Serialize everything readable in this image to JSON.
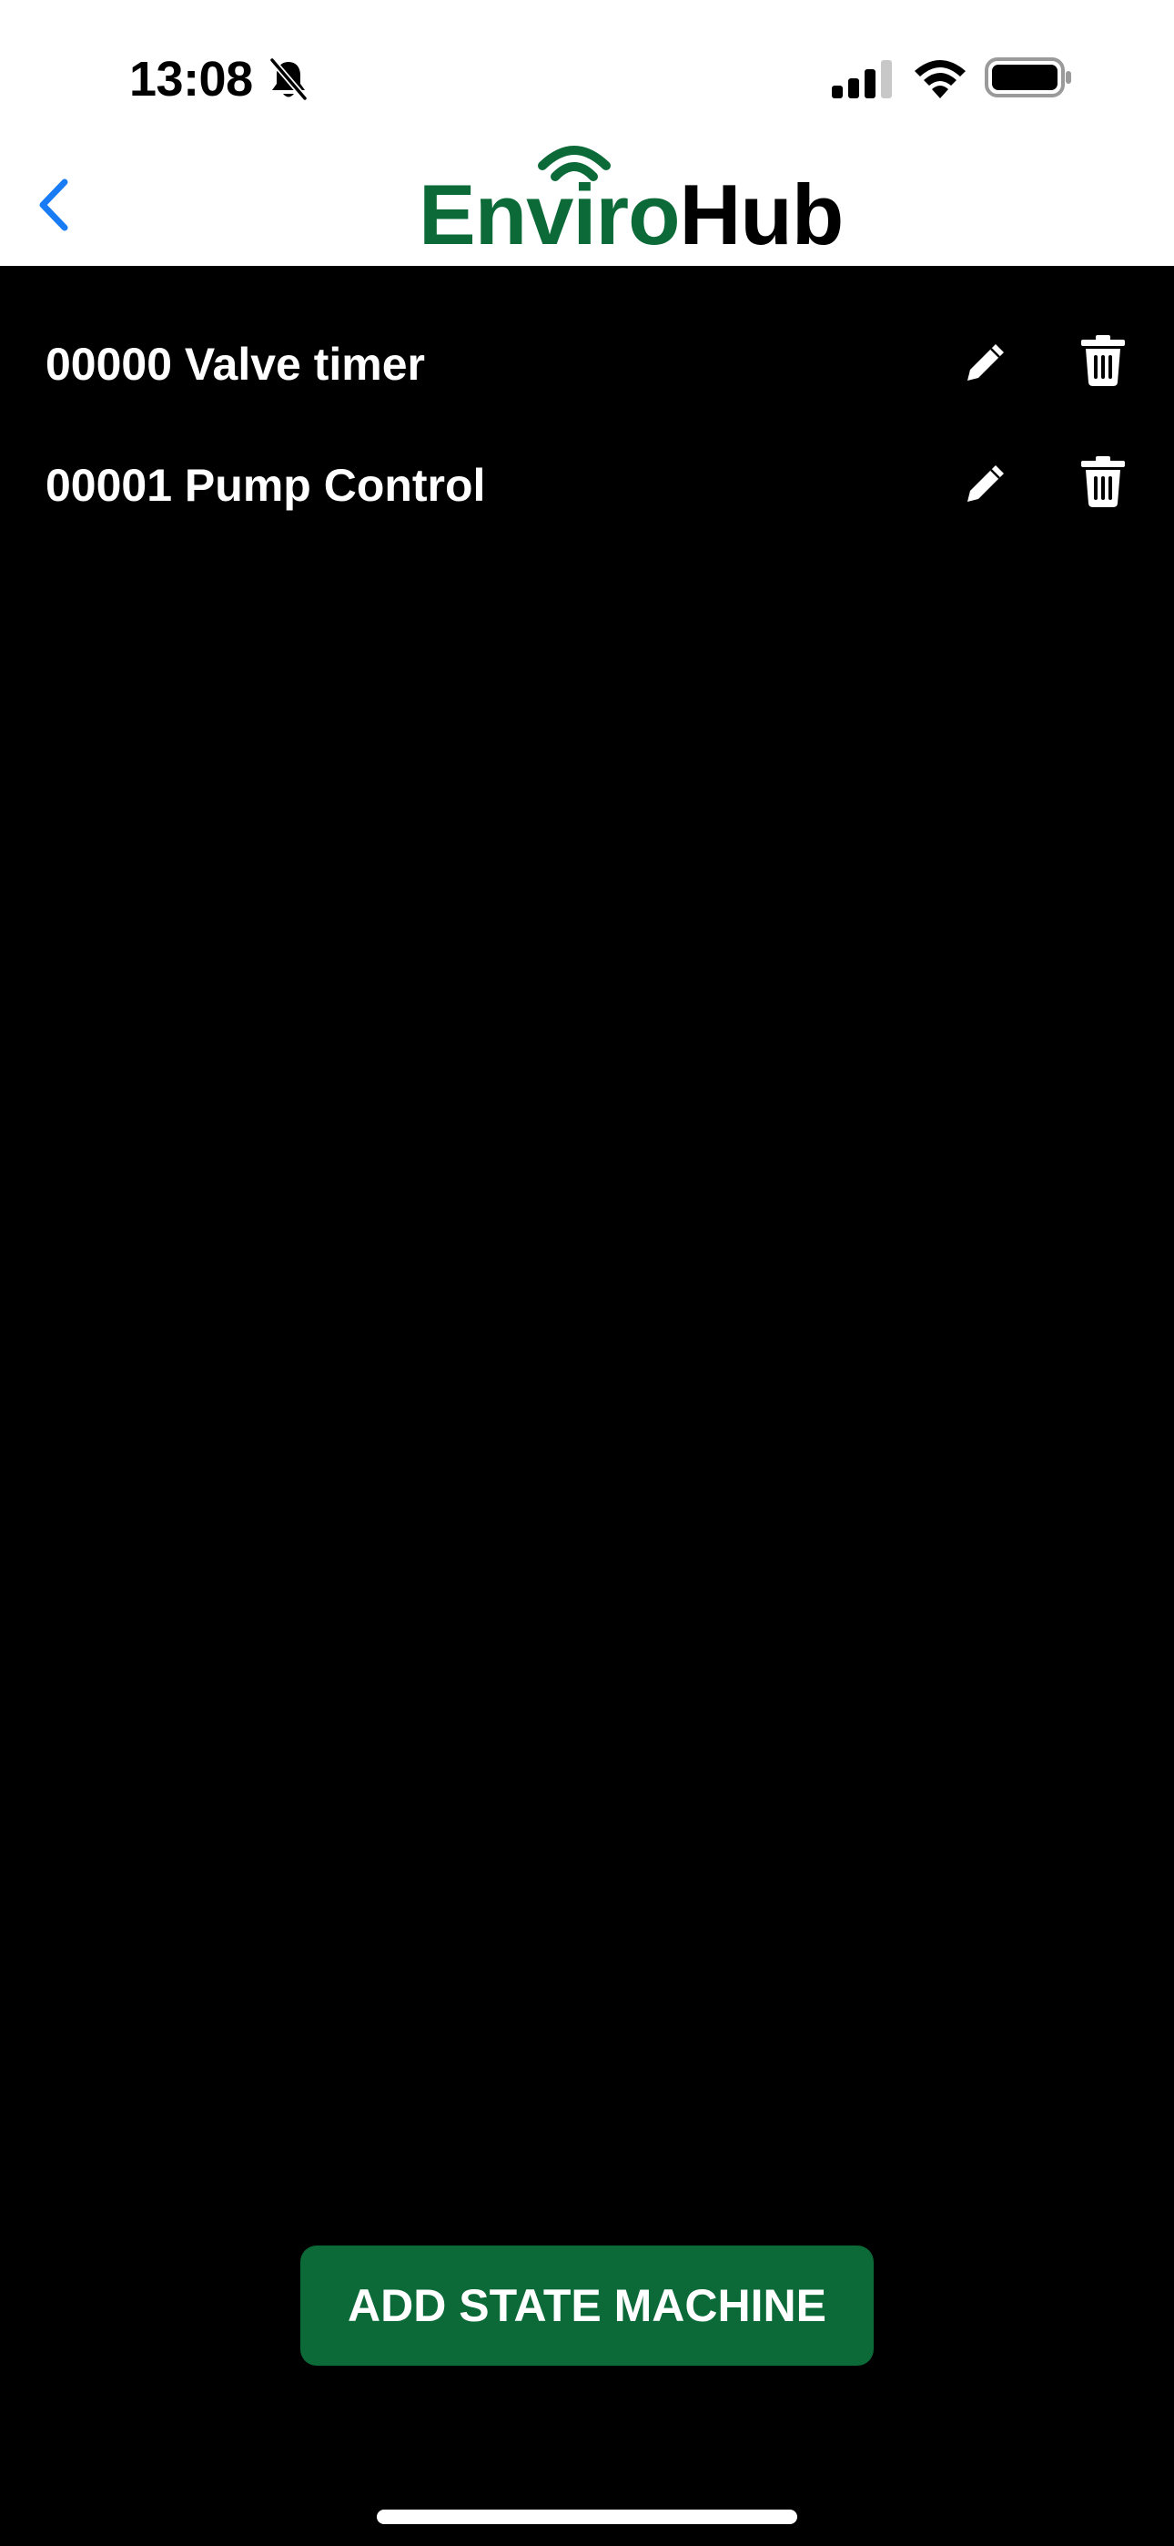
{
  "status_bar": {
    "time": "13:08",
    "icons": [
      "bell-slash-icon",
      "cellular-signal-icon",
      "wifi-icon",
      "battery-icon"
    ]
  },
  "nav": {
    "back_icon": "chevron-left-icon",
    "logo": {
      "part1": "Enviro",
      "part2": "Hub",
      "primary_color": "#0b6a38",
      "secondary_color": "#000000"
    }
  },
  "state_machines": [
    {
      "label": "00000 Valve timer"
    },
    {
      "label": "00001 Pump Control"
    }
  ],
  "actions": {
    "add_label": "ADD STATE MACHINE",
    "add_color": "#0b6a38"
  },
  "theme": {
    "background": "#000000",
    "header_background": "#ffffff",
    "accent": "#1a7cf5"
  }
}
